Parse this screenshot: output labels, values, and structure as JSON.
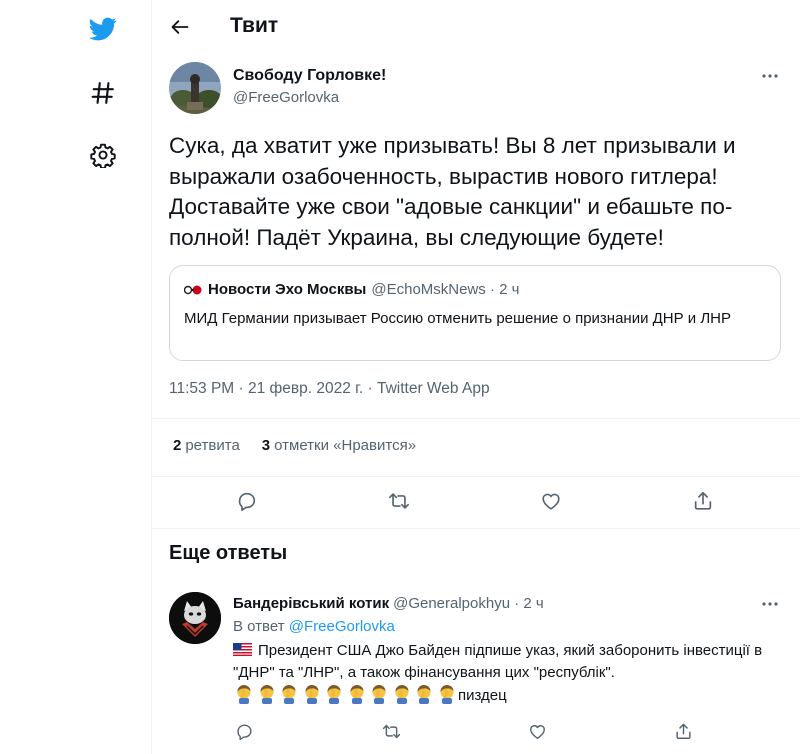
{
  "header": {
    "title": "Твит"
  },
  "tweet": {
    "author_name": "Свободу Горловке!",
    "author_handle": "@FreeGorlovka",
    "text": "Сука, да хватит уже призывать! Вы 8 лет призывали и выражали озабоченность, вырастив нового гитлера! Доставайте уже свои \"адовые санкции\" и ебашьте по-полной! Падёт Украина, вы следующие будете!",
    "quote": {
      "name": "Новости Эхо Москвы",
      "meta": "@EchoMskNews · 2 ч",
      "text": "МИД Германии призывает Россию отменить решение о признании ДНР и ЛНР"
    },
    "timestamp": "11:53 PM · 21 февр. 2022 г. · Twitter Web App",
    "stats": {
      "retweets_count": "2",
      "retweets_label": "ретвита",
      "likes_count": "3",
      "likes_label": "отметки «Нравится»"
    }
  },
  "more_replies": {
    "title": "Еще ответы",
    "reply": {
      "name": "Бандерівський котик",
      "meta": "@Generalpokhyu · 2 ч",
      "reply_to_prefix": "В ответ",
      "reply_to_handle": "@FreeGorlovka",
      "text": "Президент США Джо Байден підпише указ, який заборонить інвестиції в \"ДНР\" та \"ЛНР\", а також фінансування цих \"республік\".",
      "suffix": "пиздец"
    }
  },
  "icons": {
    "logo": "twitter-bird-icon",
    "explore": "hashtag-icon",
    "settings": "gear-icon",
    "back": "arrow-left-icon",
    "more": "more-horizontal-icon",
    "reply": "reply-icon",
    "retweet": "retweet-icon",
    "like": "heart-icon",
    "share": "share-icon",
    "flag": "us-flag-icon",
    "emoji": "facepalm-emoji-icon"
  },
  "colors": {
    "accent": "#1d9bf0",
    "text_primary": "#0f1419",
    "text_secondary": "#536471",
    "border": "#cfd9de",
    "divider": "#eff3f4"
  }
}
